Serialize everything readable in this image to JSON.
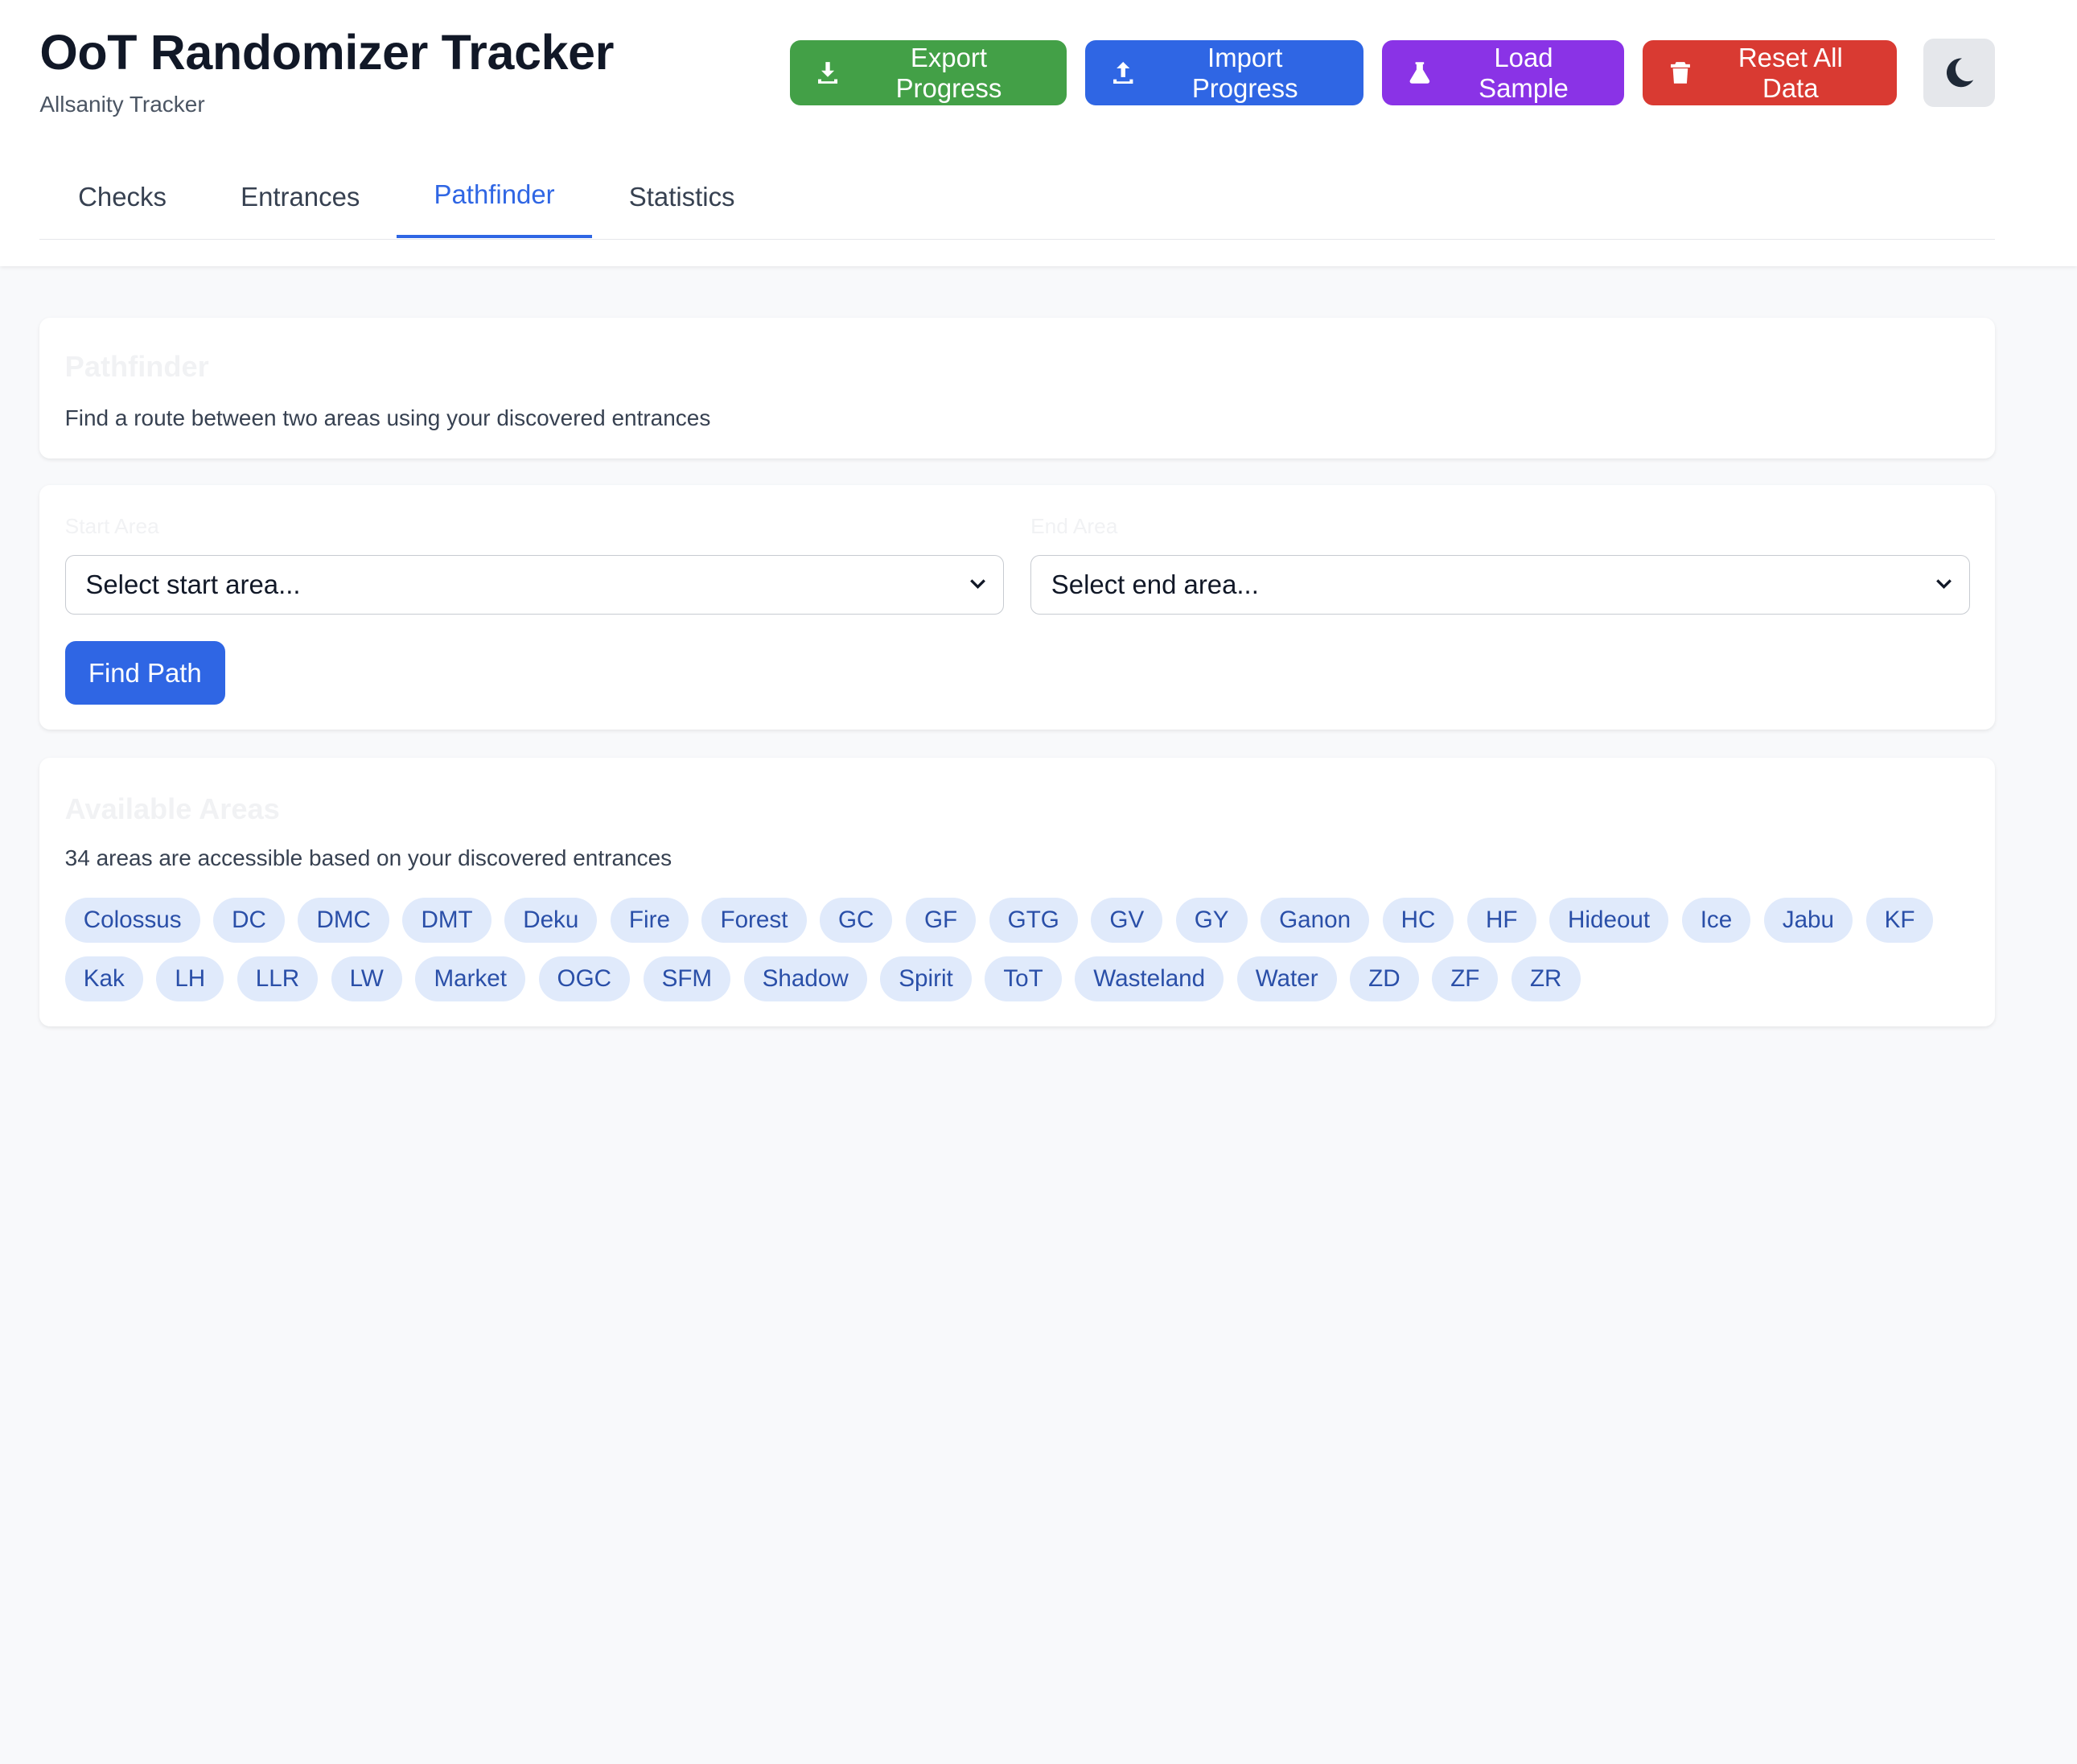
{
  "app": {
    "title": "OoT Randomizer Tracker",
    "subtitle": "Allsanity Tracker"
  },
  "actions": {
    "export_label": "Export Progress",
    "import_label": "Import Progress",
    "sample_label": "Load Sample",
    "reset_label": "Reset All Data",
    "export_icon": "download-icon",
    "import_icon": "upload-icon",
    "sample_icon": "flask-icon",
    "reset_icon": "trash-icon",
    "theme_icon": "moon-icon"
  },
  "tabs": [
    {
      "label": "Checks",
      "active": false
    },
    {
      "label": "Entrances",
      "active": false
    },
    {
      "label": "Pathfinder",
      "active": true
    },
    {
      "label": "Statistics",
      "active": false
    }
  ],
  "intro": {
    "heading": "Pathfinder",
    "description": "Find a route between two areas using your discovered entrances"
  },
  "route": {
    "start_label": "Start Area",
    "end_label": "End Area",
    "start_value": "Select start area...",
    "end_value": "Select end area...",
    "find_label": "Find Path"
  },
  "areas": {
    "heading": "Available Areas",
    "description": "34 areas are accessible based on your discovered entrances",
    "items": [
      "Colossus",
      "DC",
      "DMC",
      "DMT",
      "Deku",
      "Fire",
      "Forest",
      "GC",
      "GF",
      "GTG",
      "GV",
      "GY",
      "Ganon",
      "HC",
      "HF",
      "Hideout",
      "Ice",
      "Jabu",
      "KF",
      "Kak",
      "LH",
      "LLR",
      "LW",
      "Market",
      "OGC",
      "SFM",
      "Shadow",
      "Spirit",
      "ToT",
      "Wasteland",
      "Water",
      "ZD",
      "ZF",
      "ZR"
    ]
  },
  "colors": {
    "export": "#43a047",
    "import": "#2f66e4",
    "sample": "#8a33e6",
    "reset": "#d93a32",
    "accent": "#2f66e4"
  }
}
